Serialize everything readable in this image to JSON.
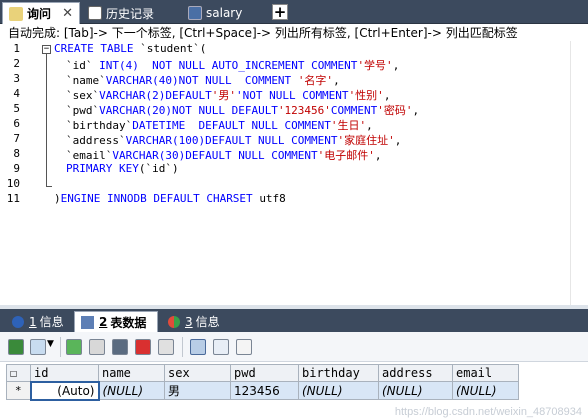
{
  "tabs": [
    {
      "label": "询问",
      "close": "✕",
      "active": true
    },
    {
      "label": "历史记录",
      "active": false
    },
    {
      "label": "salary",
      "active": false
    }
  ],
  "add_tab": "+",
  "hint": "自动完成: [Tab]-> 下一个标签, [Ctrl+Space]-> 列出所有标签, [Ctrl+Enter]-> 列出匹配标签",
  "editor": {
    "line_numbers": [
      "1",
      "2",
      "3",
      "4",
      "5",
      "6",
      "7",
      "8",
      "9",
      "10",
      "11"
    ],
    "fold_symbol": "−"
  },
  "result_tabs": [
    {
      "num": "1",
      "label": "信息",
      "active": false
    },
    {
      "num": "2",
      "label": "表数据",
      "active": true
    },
    {
      "num": "3",
      "label": "信息",
      "active": false
    }
  ],
  "grid": {
    "headers": [
      "id",
      "name",
      "sex",
      "pwd",
      "birthday",
      "address",
      "email"
    ],
    "row": {
      "marker": "*",
      "cells": [
        "(Auto)",
        "(NULL)",
        "男",
        "123456",
        "(NULL)",
        "(NULL)",
        "(NULL)"
      ]
    }
  },
  "watermark": "https://blog.csdn.net/weixin_48708934",
  "colors": {
    "accent": "#3c4a5e",
    "keyword": "#0000ff",
    "string": "#c00000",
    "selected_row": "#d8e6f6"
  }
}
